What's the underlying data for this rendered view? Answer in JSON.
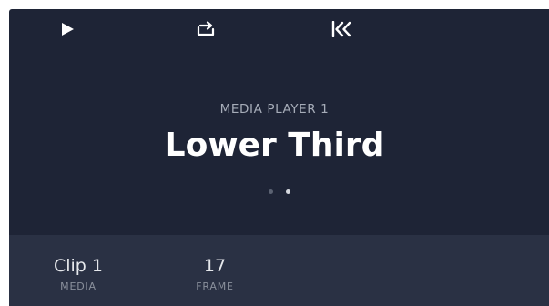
{
  "controls": {
    "play_icon": "play-icon",
    "loop_icon": "loop-icon",
    "restart_icon": "skip-to-start-icon"
  },
  "player": {
    "source_label": "MEDIA PLAYER 1",
    "clip_name": "Lower Third",
    "page_dots": {
      "count": 2,
      "active_index": 1
    }
  },
  "info": {
    "media_value": "Clip 1",
    "media_label": "MEDIA",
    "frame_value": "17",
    "frame_label": "FRAME"
  },
  "colors": {
    "panel": "#1e2436",
    "info_panel": "#2a3144",
    "text_primary": "#ffffff",
    "text_secondary": "#a6acb8"
  }
}
